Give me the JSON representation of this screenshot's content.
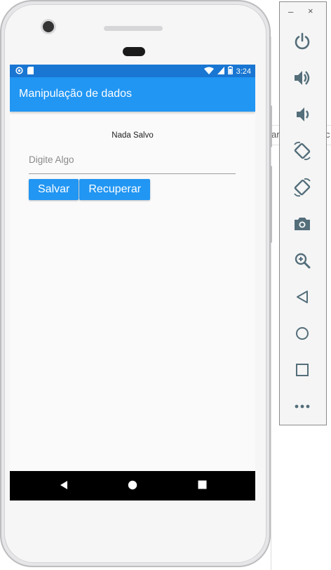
{
  "app": {
    "title": "Manipulação de dados",
    "status_text": "Nada Salvo",
    "input": {
      "placeholder": "Digite Algo",
      "value": ""
    },
    "buttons": {
      "save": "Salvar",
      "load": "Recuperar"
    }
  },
  "status_bar": {
    "time": "3:24"
  },
  "toolbar": {
    "minimize": "–",
    "close": "×"
  },
  "background_fragment": {
    "text_1": "ar",
    "text_2": "c"
  },
  "colors": {
    "primary": "#2196f3",
    "status_bar": "#1976d2",
    "nav_bar": "#000000",
    "toolbar_icon": "#546e7a"
  }
}
